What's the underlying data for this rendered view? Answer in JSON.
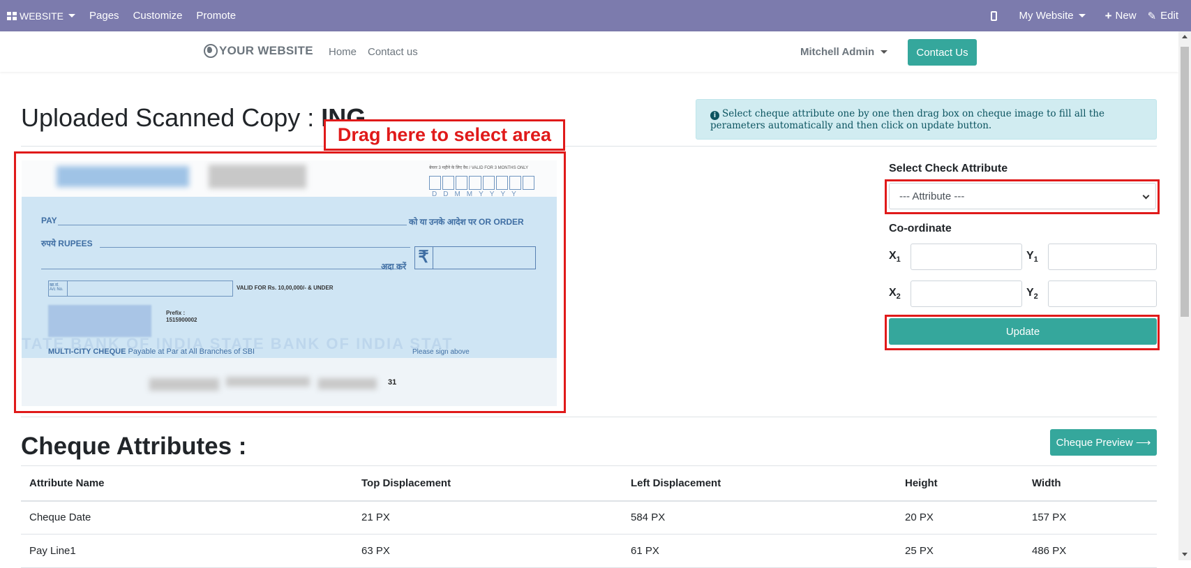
{
  "admin_bar": {
    "website_menu": "WEBSITE",
    "pages": "Pages",
    "customize": "Customize",
    "promote": "Promote",
    "my_website": "My Website",
    "new": "New",
    "edit": "Edit"
  },
  "site_header": {
    "logo_text": "YOUR WEBSITE",
    "nav": [
      "Home",
      "Contact us"
    ],
    "user_name": "Mitchell Admin",
    "contact_button": "Contact Us"
  },
  "main": {
    "title_prefix": "Uploaded Scanned Copy : ",
    "title_bold": "ING",
    "drag_label": "Drag here to select area",
    "info_text": "Select cheque attribute one by one then drag box on cheque image to fill all the perameters automatically and then click on update button."
  },
  "cheque_image": {
    "valid_note": "बेयरर 3 महीने के लिए वैध / VALID FOR 3 MONTHS ONLY",
    "date_letters": "DDMMYYYY",
    "pay": "PAY",
    "or_order": "को या उनके आदेश पर  OR ORDER",
    "rupees": "रुपये RUPEES",
    "ada_karen": "अदा करें",
    "rupee_symbol": "₹",
    "acno": "खा.सं. A/c No.",
    "valid_for": "VALID FOR Rs. 10,00,000/- & UNDER",
    "prefix_label": "Prefix :",
    "prefix_value": "1515900002",
    "multi_city": "MULTI-CITY CHEQUE",
    "payable_text": "Payable at Par at All Branches of SBI",
    "please_sign": "Please sign above",
    "watermark": "TATE BANK OF INDIA STATE BANK OF INDIA STAT",
    "micr_tail": "31"
  },
  "form": {
    "select_label": "Select Check Attribute",
    "select_value": "--- Attribute ---",
    "coord_label": "Co-ordinate",
    "x1": "X",
    "x1_sub": "1",
    "y1": "Y",
    "y1_sub": "1",
    "x2": "X",
    "x2_sub": "2",
    "y2": "Y",
    "y2_sub": "2",
    "update_button": "Update"
  },
  "attributes": {
    "title": "Cheque Attributes :",
    "preview_button": "Cheque Preview ⟶",
    "columns": [
      "Attribute Name",
      "Top Displacement",
      "Left Displacement",
      "Height",
      "Width"
    ],
    "rows": [
      [
        "Cheque Date",
        "21 PX",
        "584 PX",
        "20 PX",
        "157 PX"
      ],
      [
        "Pay Line1",
        "63 PX",
        "61 PX",
        "25 PX",
        "486 PX"
      ]
    ]
  },
  "colors": {
    "admin_bar": "#7c7bad",
    "accent": "#35a79c",
    "annotation": "#e01a1a",
    "info_bg": "#d1ecf1"
  }
}
